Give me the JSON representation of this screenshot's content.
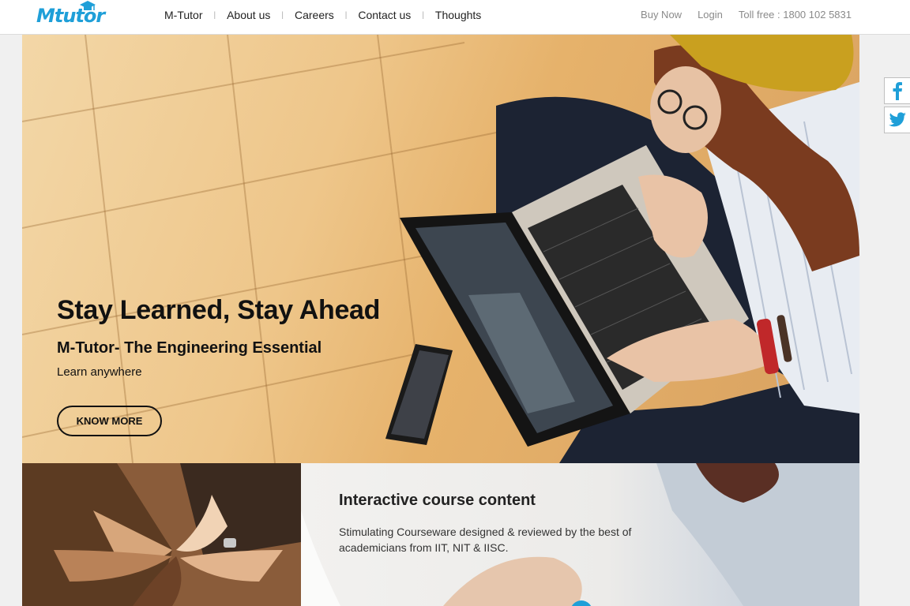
{
  "header": {
    "logo_text": "Mtutor",
    "nav": [
      "M-Tutor",
      "About us",
      "Careers",
      "Contact us",
      "Thoughts"
    ],
    "nav_separator": "|",
    "buy_now": "Buy Now",
    "login": "Login",
    "toll_free": "Toll free : 1800 102 5831"
  },
  "hero": {
    "title": "Stay Learned, Stay Ahead",
    "subtitle": "M-Tutor- The Engineering Essential",
    "tagline": "Learn anywhere",
    "cta": "KNOW MORE"
  },
  "social": {
    "facebook_icon": "facebook-icon",
    "twitter_icon": "twitter-icon"
  },
  "feature": {
    "title": "Interactive course content",
    "description": "Stimulating Courseware designed & reviewed by the best of academicians from IIT, NIT & IISC."
  },
  "colors": {
    "brand": "#1f9fd8",
    "text_dark": "#111111",
    "nav_muted": "#8a8a8a"
  }
}
